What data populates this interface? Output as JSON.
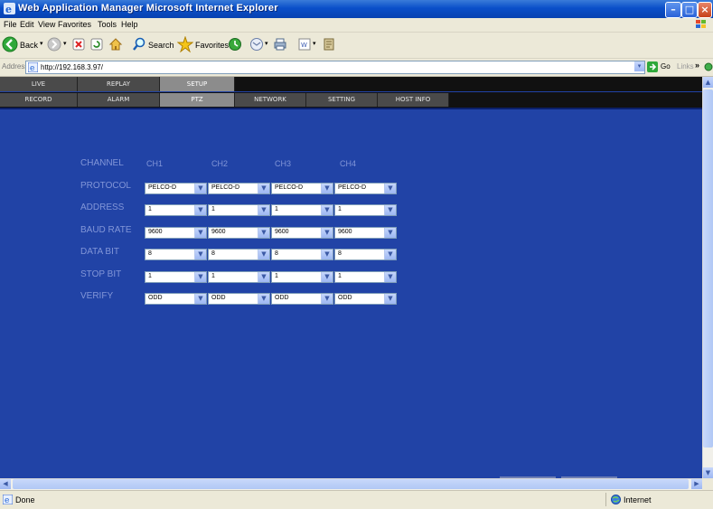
{
  "window": {
    "title": "Web Application Manager  Microsoft Internet Explorer",
    "accent": "#0a4fc9"
  },
  "menu": [
    "File",
    "Edit",
    "View",
    "Favorites",
    "Tools",
    "Help"
  ],
  "toolbar": {
    "back": "Back",
    "search": "Search",
    "favorites": "Favorites"
  },
  "address": {
    "label": "Address",
    "url": "http://192.168.3.97/",
    "go": "Go",
    "links": "Links"
  },
  "tabs_top": [
    "LIVE",
    "REPLAY",
    "SETUP"
  ],
  "tabs_top_active": "SETUP",
  "tabs_sub": [
    "RECORD",
    "ALARM",
    "PTZ",
    "NETWORK",
    "SETTING",
    "HOST INFO"
  ],
  "tabs_sub_active": "PTZ",
  "ptz": {
    "channel_label": "CHANNEL",
    "channels": [
      "CH1",
      "CH2",
      "CH3",
      "CH4"
    ],
    "rows": [
      {
        "label": "PROTOCOL",
        "values": [
          "PELCO-D",
          "PELCO-D",
          "PELCO-D",
          "PELCO-D"
        ]
      },
      {
        "label": "ADDRESS",
        "values": [
          "1",
          "1",
          "1",
          "1"
        ]
      },
      {
        "label": "BAUD RATE",
        "values": [
          "9600",
          "9600",
          "9600",
          "9600"
        ]
      },
      {
        "label": "DATA BIT",
        "values": [
          "8",
          "8",
          "8",
          "8"
        ]
      },
      {
        "label": "STOP BIT",
        "values": [
          "1",
          "1",
          "1",
          "1"
        ]
      },
      {
        "label": "VERIFY",
        "values": [
          "ODD",
          "ODD",
          "ODD",
          "ODD"
        ]
      }
    ]
  },
  "status": {
    "left": "Done",
    "zone": "Internet"
  },
  "colors": {
    "content_bg": "#2143a6",
    "label": "#8296d8"
  }
}
